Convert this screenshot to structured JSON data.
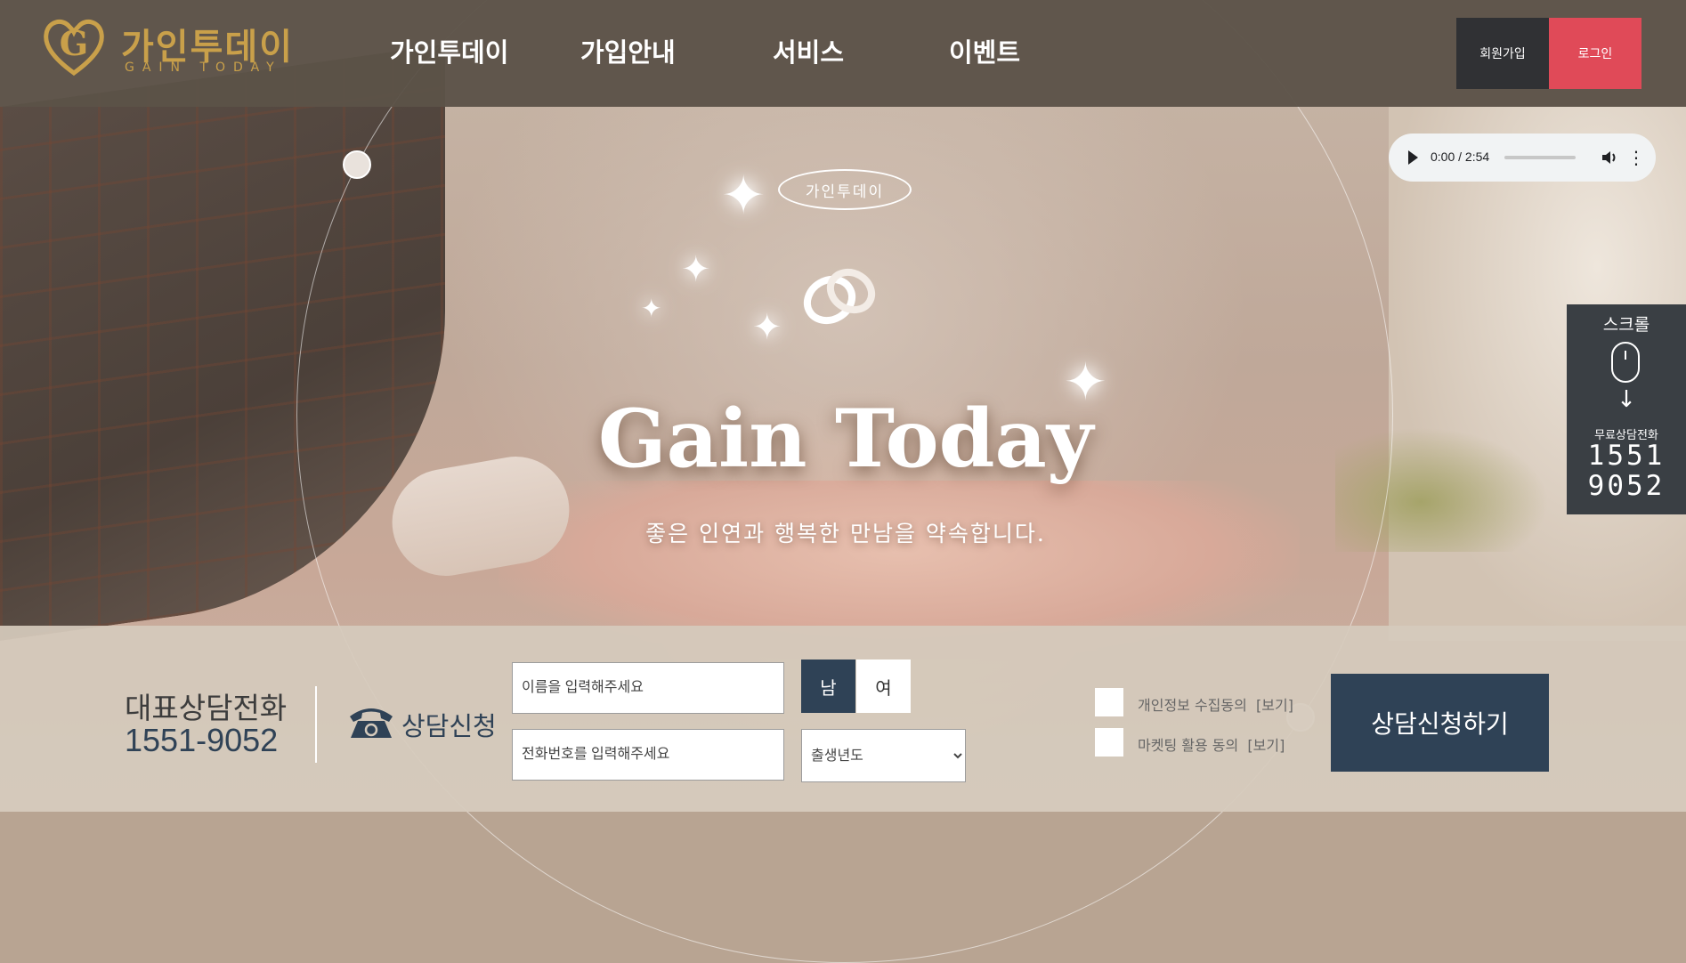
{
  "header": {
    "logo_ko": "가인투데이",
    "logo_en": "GAIN TODAY",
    "nav": [
      "가인투데이",
      "가입안내",
      "서비스",
      "이벤트"
    ],
    "signup": "회원가입",
    "login": "로그인"
  },
  "audio": {
    "time": "0:00 / 2:54"
  },
  "hero": {
    "badge": "가인투데이",
    "headline": "Gain Today",
    "subline": "좋은 인연과 행복한 만남을 약속합니다."
  },
  "side": {
    "scroll": "스크롤",
    "label": "무료상담전화",
    "num1": "1551",
    "num2": "9052"
  },
  "form": {
    "rep_title": "대표상담전화",
    "rep_number": "1551-9052",
    "apply_label": "상담신청",
    "name_placeholder": "이름을 입력해주세요",
    "phone_placeholder": "전화번호를 입력해주세요",
    "male": "남",
    "female": "여",
    "birth_year": "출생년도",
    "privacy": "개인정보 수집동의",
    "marketing": "마켓팅 활용 동의",
    "view": "[보기]",
    "submit": "상담신청하기"
  },
  "colors": {
    "accent_navy": "#2f4256",
    "login_red": "#e04a58",
    "logo_gold": "#c9a04a"
  }
}
